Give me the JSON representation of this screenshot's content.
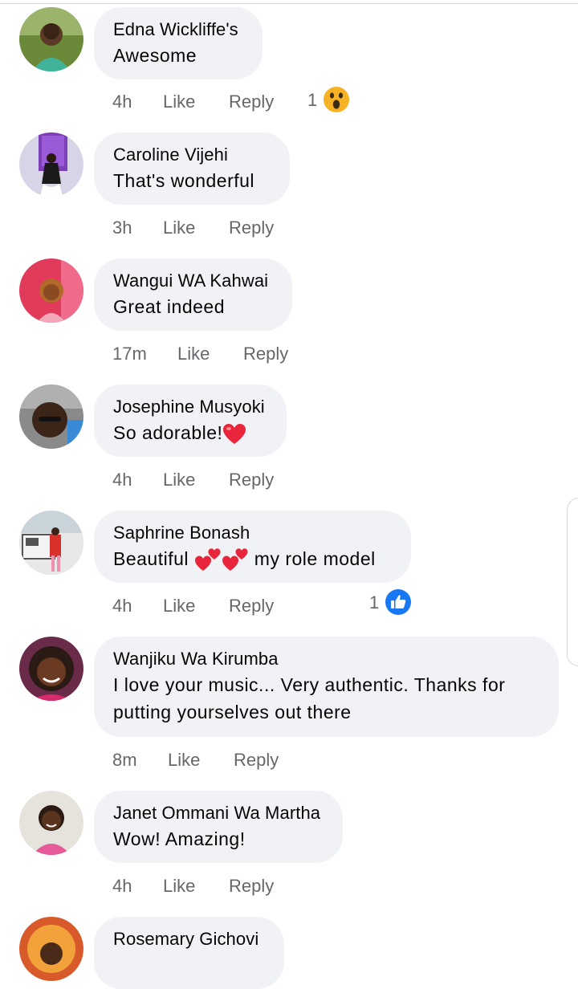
{
  "comments": [
    {
      "author": "Edna Wickliffe's",
      "text": "Awesome",
      "time": "4h",
      "like": "Like",
      "reply": "Reply",
      "reaction_count": "1",
      "reaction": "wow"
    },
    {
      "author": "Caroline Vijehi",
      "text": "That's wonderful",
      "time": "3h",
      "like": "Like",
      "reply": "Reply"
    },
    {
      "author": "Wangui WA Kahwai",
      "text": "Great indeed",
      "time": "17m",
      "like": "Like",
      "reply": "Reply"
    },
    {
      "author": "Josephine Musyoki",
      "text": "So adorable!",
      "time": "4h",
      "like": "Like",
      "reply": "Reply"
    },
    {
      "author": "Saphrine Bonash",
      "text_before": "Beautiful",
      "text_after": "my role model",
      "time": "4h",
      "like": "Like",
      "reply": "Reply",
      "reaction_count": "1",
      "reaction": "like"
    },
    {
      "author": "Wanjiku Wa Kirumba",
      "text_line1": "I love your music... Very authentic. Thanks for",
      "text_line2": "putting yourselves out there",
      "time": "8m",
      "like": "Like",
      "reply": "Reply"
    },
    {
      "author": "Janet Ommani Wa Martha",
      "text": "Wow! Amazing!",
      "time": "4h",
      "like": "Like",
      "reply": "Reply"
    },
    {
      "author": "Rosemary Gichovi"
    }
  ],
  "colors": {
    "bubble": "#f0f2f5",
    "meta": "#65676b",
    "like_blue": "#1877f2",
    "heart_red": "#e8253a",
    "wow_yellow": "#f7b125"
  }
}
